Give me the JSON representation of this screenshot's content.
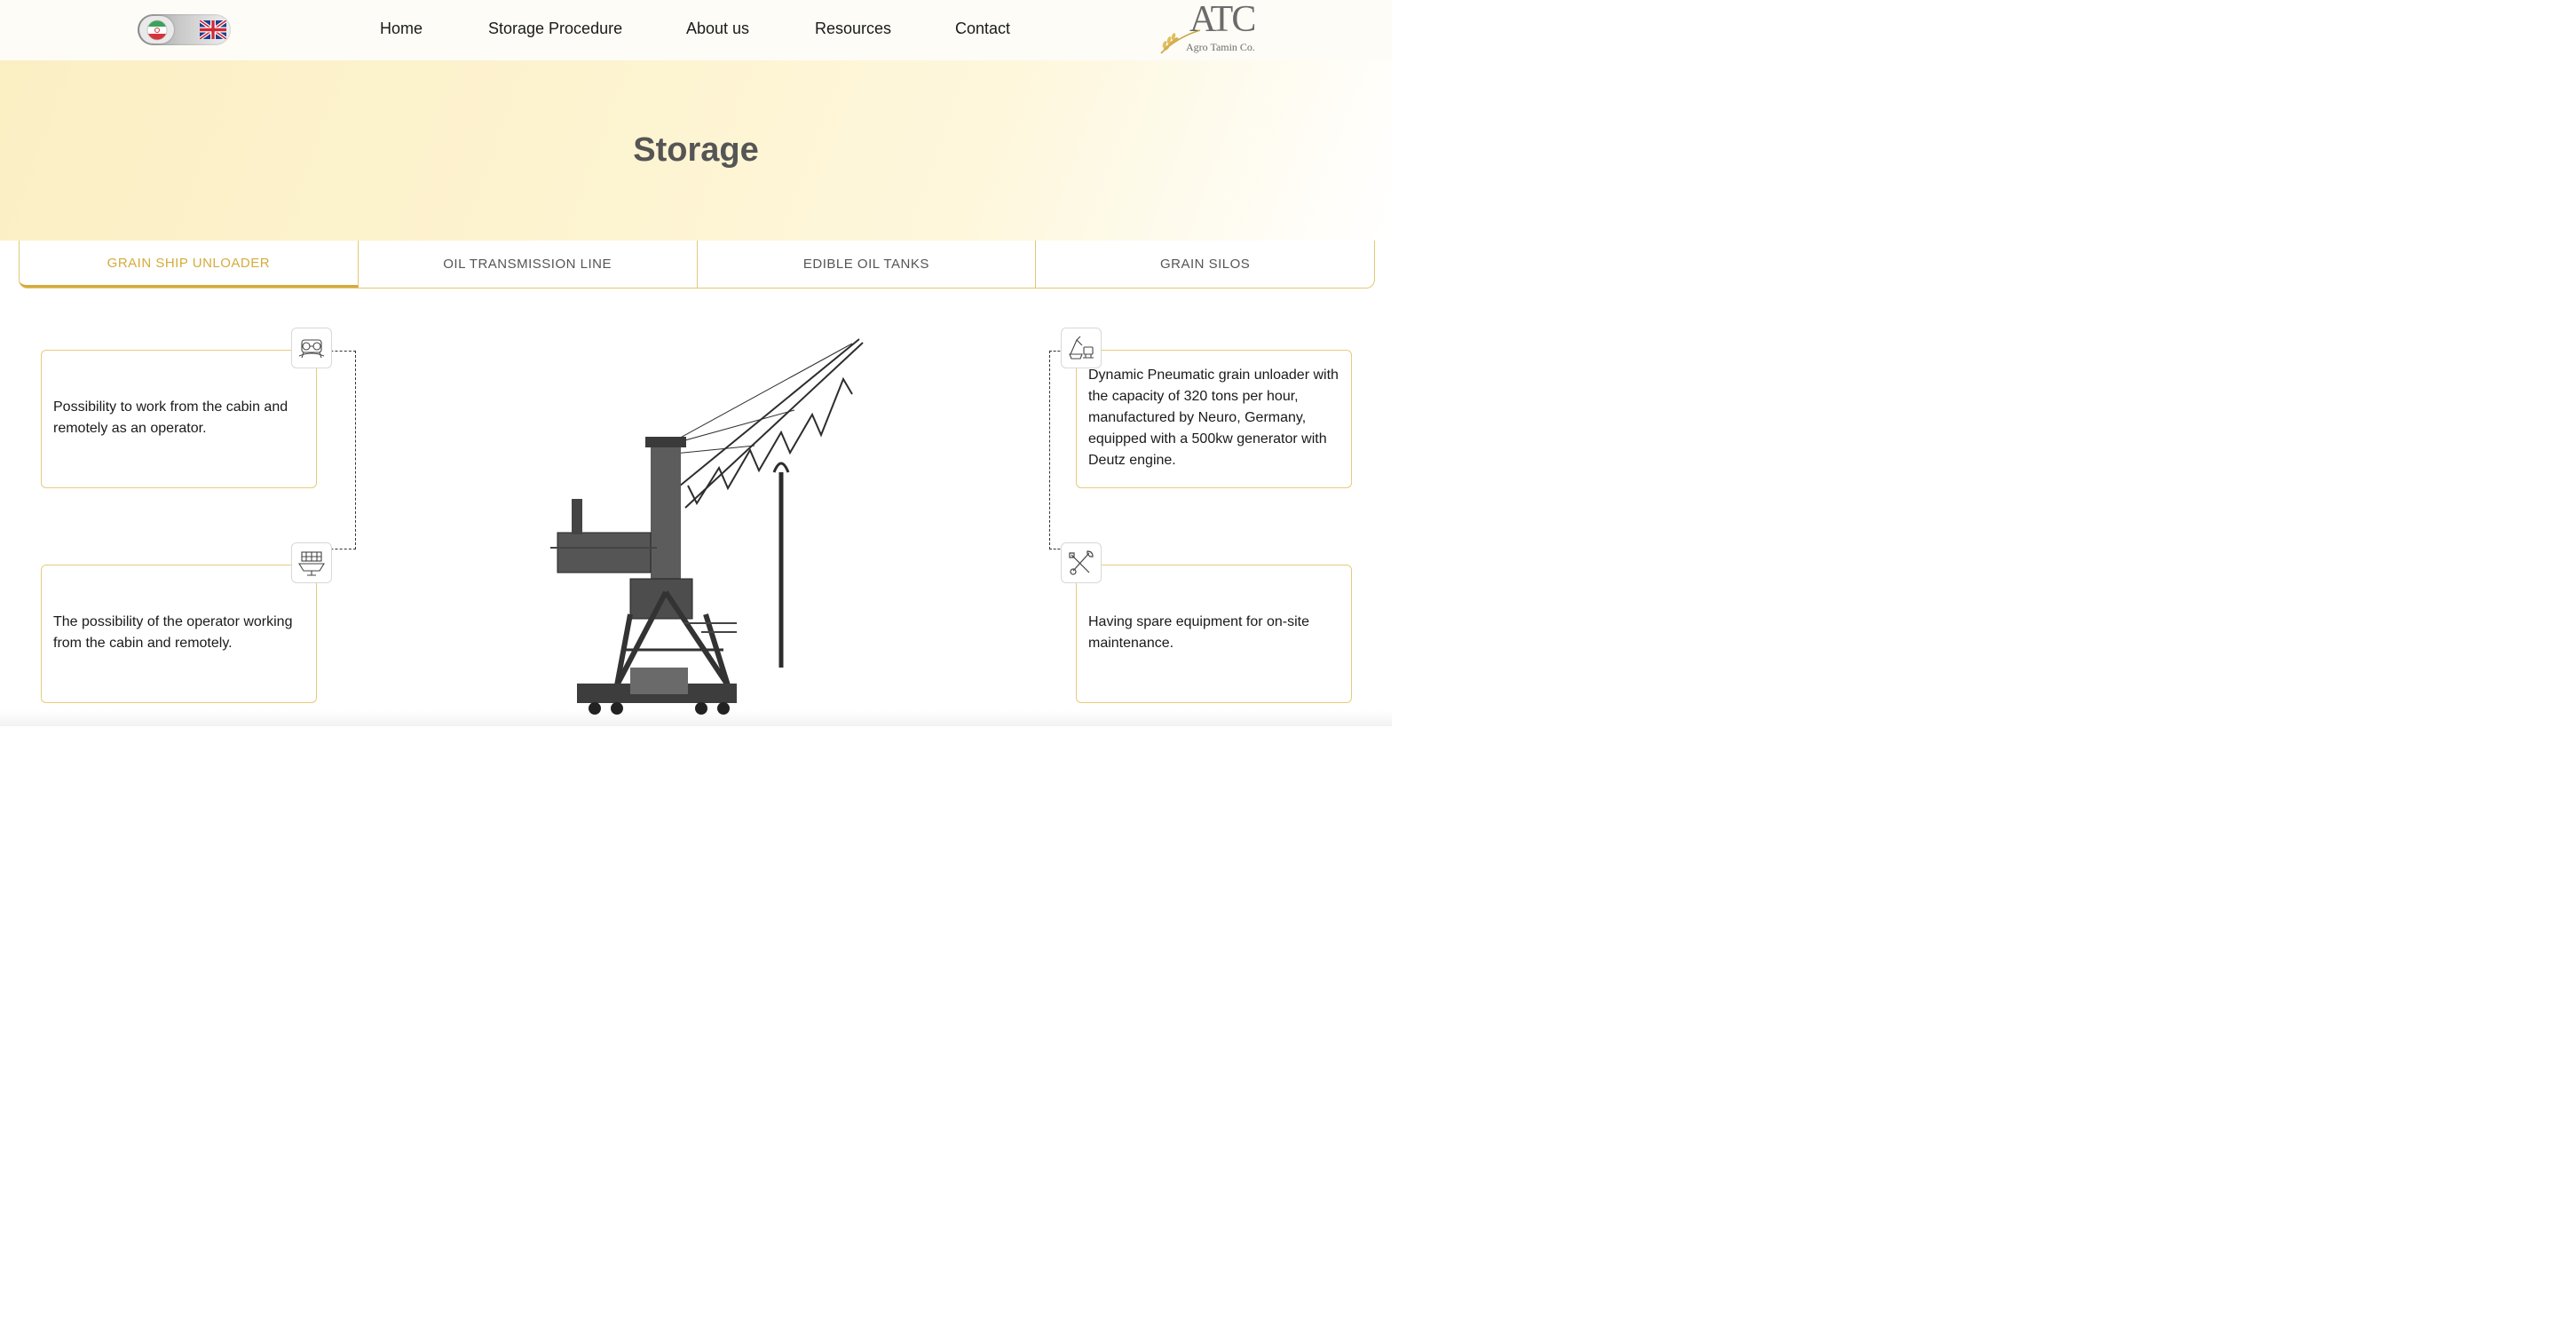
{
  "header": {
    "nav": [
      "Home",
      "Storage Procedure",
      "About us",
      "Resources",
      "Contact"
    ],
    "logo": {
      "mark": "ATC",
      "subtitle": "Agro Tamin Co."
    },
    "language_toggle": {
      "left_flag": "iran-flag-icon",
      "right_flag": "uk-flag-icon"
    }
  },
  "hero": {
    "title": "Storage"
  },
  "tabs": [
    {
      "label": "GRAIN SHIP UNLOADER",
      "active": true
    },
    {
      "label": "OIL TRANSMISSION LINE",
      "active": false
    },
    {
      "label": "EDIBLE OIL TANKS",
      "active": false
    },
    {
      "label": "GRAIN SILOS",
      "active": false
    }
  ],
  "features": {
    "top_left": {
      "icon": "operator-cabin-icon",
      "text": "Possibility to work from the cabin and remotely as an operator."
    },
    "bottom_left": {
      "icon": "control-panel-icon",
      "text": "The possibility of the operator working from the cabin and remotely."
    },
    "top_right": {
      "icon": "ship-unloader-icon",
      "text": "Dynamic Pneumatic grain unloader with the capacity of 320 tons per hour, manufactured by Neuro, Germany, equipped with a 500kw generator with Deutz engine."
    },
    "bottom_right": {
      "icon": "tools-icon",
      "text": "Having spare equipment for on-site maintenance."
    }
  },
  "image": {
    "icon": "pneumatic-crane-image"
  },
  "colors": {
    "accent": "#d4ab3c",
    "border": "#e5cc7c",
    "hero_bg": "#fdf3cf",
    "title": "#555555"
  }
}
